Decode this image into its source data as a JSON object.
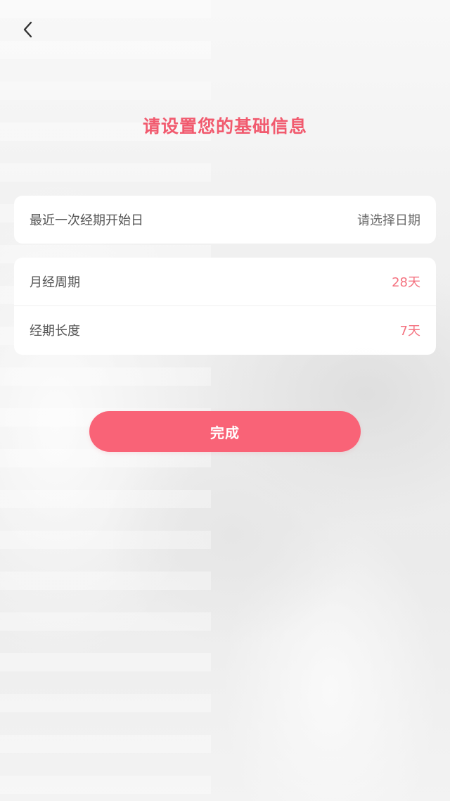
{
  "header": {
    "back_icon": "chevron-left-icon",
    "title": "请设置您的基础信息"
  },
  "last_period": {
    "label": "最近一次经期开始日",
    "placeholder": "请选择日期"
  },
  "cycle": {
    "label": "月经周期",
    "value": "28天"
  },
  "period_length": {
    "label": "经期长度",
    "value": "7天"
  },
  "actions": {
    "done_label": "完成"
  },
  "colors": {
    "accent": "#f15a6e",
    "button": "#f96377",
    "value_accent": "#f4717f"
  }
}
